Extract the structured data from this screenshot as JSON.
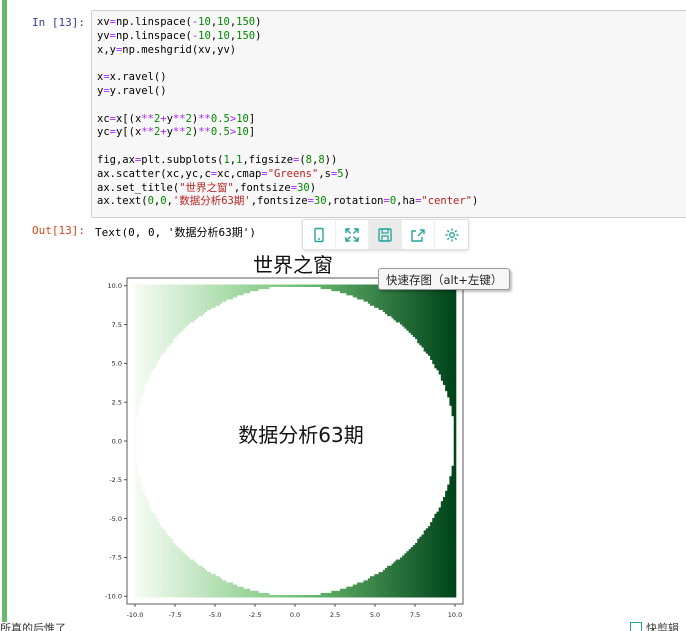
{
  "cell": {
    "in_prompt": "In [13]:",
    "out_prompt": "Out[13]:",
    "output_text": "Text(0, 0, '数据分析63期')",
    "code_lines": [
      [
        {
          "t": "xv"
        },
        {
          "t": "=",
          "c": "#aa22ff"
        },
        {
          "t": "np.linspace(",
          "c": "#000"
        },
        {
          "t": "-",
          "c": "#aa22ff"
        },
        {
          "t": "10",
          "c": "#008800"
        },
        {
          "t": ",",
          "c": "#000"
        },
        {
          "t": "10",
          "c": "#008800"
        },
        {
          "t": ",",
          "c": "#000"
        },
        {
          "t": "150",
          "c": "#008800"
        },
        {
          "t": ")"
        }
      ],
      [
        {
          "t": "yv"
        },
        {
          "t": "=",
          "c": "#aa22ff"
        },
        {
          "t": "np.linspace("
        },
        {
          "t": "-",
          "c": "#aa22ff"
        },
        {
          "t": "10",
          "c": "#008800"
        },
        {
          "t": ","
        },
        {
          "t": "10",
          "c": "#008800"
        },
        {
          "t": ","
        },
        {
          "t": "150",
          "c": "#008800"
        },
        {
          "t": ")"
        }
      ],
      [
        {
          "t": "x,y"
        },
        {
          "t": "=",
          "c": "#aa22ff"
        },
        {
          "t": "np.meshgrid(xv,yv)"
        }
      ],
      [
        {
          "t": ""
        }
      ],
      [
        {
          "t": "x"
        },
        {
          "t": "=",
          "c": "#aa22ff"
        },
        {
          "t": "x.ravel()"
        }
      ],
      [
        {
          "t": "y"
        },
        {
          "t": "=",
          "c": "#aa22ff"
        },
        {
          "t": "y.ravel()"
        }
      ],
      [
        {
          "t": ""
        }
      ],
      [
        {
          "t": "xc"
        },
        {
          "t": "=",
          "c": "#aa22ff"
        },
        {
          "t": "x[(x"
        },
        {
          "t": "**",
          "c": "#aa22ff"
        },
        {
          "t": "2",
          "c": "#008800"
        },
        {
          "t": "+",
          "c": "#aa22ff"
        },
        {
          "t": "y"
        },
        {
          "t": "**",
          "c": "#aa22ff"
        },
        {
          "t": "2",
          "c": "#008800"
        },
        {
          "t": ")"
        },
        {
          "t": "**",
          "c": "#aa22ff"
        },
        {
          "t": "0.5",
          "c": "#008800"
        },
        {
          "t": ">",
          "c": "#aa22ff"
        },
        {
          "t": "10",
          "c": "#008800"
        },
        {
          "t": "]"
        }
      ],
      [
        {
          "t": "yc"
        },
        {
          "t": "=",
          "c": "#aa22ff"
        },
        {
          "t": "y[(x"
        },
        {
          "t": "**",
          "c": "#aa22ff"
        },
        {
          "t": "2",
          "c": "#008800"
        },
        {
          "t": "+",
          "c": "#aa22ff"
        },
        {
          "t": "y"
        },
        {
          "t": "**",
          "c": "#aa22ff"
        },
        {
          "t": "2",
          "c": "#008800"
        },
        {
          "t": ")"
        },
        {
          "t": "**",
          "c": "#aa22ff"
        },
        {
          "t": "0.5",
          "c": "#008800"
        },
        {
          "t": ">",
          "c": "#aa22ff"
        },
        {
          "t": "10",
          "c": "#008800"
        },
        {
          "t": "]"
        }
      ],
      [
        {
          "t": ""
        }
      ],
      [
        {
          "t": "fig,ax"
        },
        {
          "t": "=",
          "c": "#aa22ff"
        },
        {
          "t": "plt.subplots("
        },
        {
          "t": "1",
          "c": "#008800"
        },
        {
          "t": ","
        },
        {
          "t": "1",
          "c": "#008800"
        },
        {
          "t": ",figsize"
        },
        {
          "t": "=",
          "c": "#aa22ff"
        },
        {
          "t": "("
        },
        {
          "t": "8",
          "c": "#008800"
        },
        {
          "t": ","
        },
        {
          "t": "8",
          "c": "#008800"
        },
        {
          "t": "))"
        }
      ],
      [
        {
          "t": "ax.scatter(xc,yc,c"
        },
        {
          "t": "=",
          "c": "#aa22ff"
        },
        {
          "t": "xc,cmap"
        },
        {
          "t": "=",
          "c": "#aa22ff"
        },
        {
          "t": "\"Greens\"",
          "c": "#ba2121"
        },
        {
          "t": ",s"
        },
        {
          "t": "=",
          "c": "#aa22ff"
        },
        {
          "t": "5",
          "c": "#008800"
        },
        {
          "t": ")"
        }
      ],
      [
        {
          "t": "ax.set_title("
        },
        {
          "t": "\"世界之窗\"",
          "c": "#ba2121"
        },
        {
          "t": ",fontsize"
        },
        {
          "t": "=",
          "c": "#aa22ff"
        },
        {
          "t": "30",
          "c": "#008800"
        },
        {
          "t": ")"
        }
      ],
      [
        {
          "t": "ax.text("
        },
        {
          "t": "0",
          "c": "#008800"
        },
        {
          "t": ","
        },
        {
          "t": "0",
          "c": "#008800"
        },
        {
          "t": ","
        },
        {
          "t": "'数据分析63期'",
          "c": "#ba2121"
        },
        {
          "t": ",fontsize"
        },
        {
          "t": "=",
          "c": "#aa22ff"
        },
        {
          "t": "30",
          "c": "#008800"
        },
        {
          "t": ",rotation"
        },
        {
          "t": "=",
          "c": "#aa22ff"
        },
        {
          "t": "0",
          "c": "#008800"
        },
        {
          "t": ",ha"
        },
        {
          "t": "=",
          "c": "#aa22ff"
        },
        {
          "t": "\"center\"",
          "c": "#ba2121"
        },
        {
          "t": ")"
        }
      ]
    ]
  },
  "toolbar": {
    "icons": [
      "phone-icon",
      "expand-icon",
      "save-icon",
      "share-icon",
      "settings-icon"
    ],
    "tooltip": "快速存图（alt+左键）",
    "accent": "#26a69a"
  },
  "bottom": {
    "left_text": "所真的后惟了",
    "right_text": "快剪辑"
  },
  "chart_data": {
    "type": "scatter",
    "title": "世界之窗",
    "annotation": {
      "text": "数据分析63期",
      "x": 0,
      "y": 0
    },
    "xlim": [
      -10.5,
      10.5
    ],
    "ylim": [
      -10.5,
      10.5
    ],
    "xticks": [
      "-10.0",
      "-7.5",
      "-5.0",
      "-2.5",
      "0.0",
      "2.5",
      "5.0",
      "7.5",
      "10.0"
    ],
    "yticks": [
      "10.0",
      "7.5",
      "5.0",
      "2.5",
      "0.0",
      "-2.5",
      "-5.0",
      "-7.5",
      "-10.0"
    ],
    "grid_range": [
      -10,
      10
    ],
    "grid_points": 150,
    "mask_radius": 10,
    "colormap": "Greens",
    "color_by": "x",
    "colors": {
      "low": "#f7fcf5",
      "mid": "#74c476",
      "high": "#00441b"
    }
  }
}
